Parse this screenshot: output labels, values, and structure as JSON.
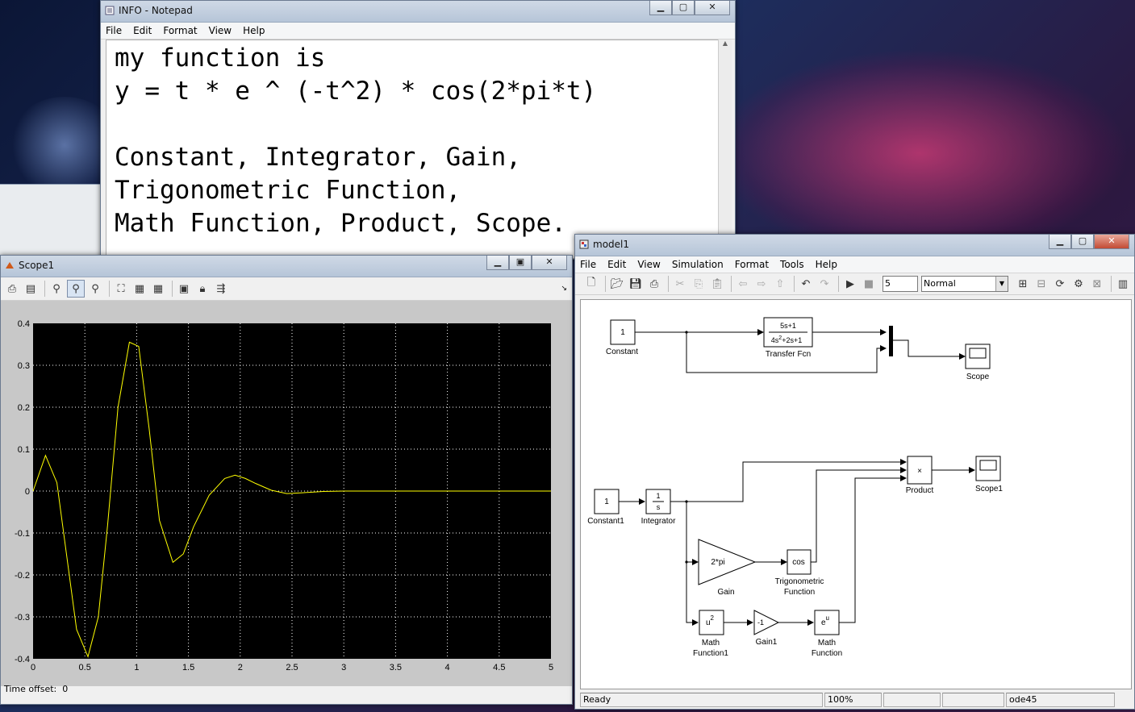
{
  "notepad": {
    "title": "INFO - Notepad",
    "menu": [
      "File",
      "Edit",
      "Format",
      "View",
      "Help"
    ],
    "lines": [
      "my function is",
      "y = t * e ^ (-t^2) * cos(2*pi*t)",
      "",
      "Constant, Integrator, Gain,",
      "Trigonometric Function,",
      "Math Function, Product, Scope."
    ]
  },
  "scope": {
    "title": "Scope1",
    "time_offset_label": "Time offset:",
    "time_offset_value": "0"
  },
  "chart_data": {
    "type": "line",
    "background": "#000000",
    "line_color": "#ffff00",
    "grid": true,
    "xlim": [
      0,
      5
    ],
    "ylim": [
      -0.4,
      0.4
    ],
    "xticks": [
      "0",
      "0.5",
      "1",
      "1.5",
      "2",
      "2.5",
      "3",
      "3.5",
      "4",
      "4.5",
      "5"
    ],
    "yticks": [
      "0.4",
      "0.3",
      "0.2",
      "0.1",
      "0",
      "-0.1",
      "-0.2",
      "-0.3",
      "-0.4"
    ],
    "x": [
      0,
      0.12,
      0.23,
      0.42,
      0.53,
      0.63,
      0.72,
      0.82,
      0.93,
      1.02,
      1.12,
      1.22,
      1.35,
      1.45,
      1.55,
      1.7,
      1.85,
      1.95,
      2.05,
      2.15,
      2.3,
      2.45,
      2.6,
      2.8,
      3.0,
      3.5,
      4.0,
      4.5,
      5.0
    ],
    "y": [
      0,
      0.085,
      0.02,
      -0.33,
      -0.395,
      -0.3,
      -0.08,
      0.2,
      0.355,
      0.345,
      0.15,
      -0.07,
      -0.17,
      -0.15,
      -0.085,
      -0.01,
      0.03,
      0.038,
      0.03,
      0.018,
      0.002,
      -0.006,
      -0.004,
      -0.001,
      0,
      0,
      0,
      0,
      0
    ]
  },
  "model": {
    "title": "model1",
    "menu": [
      "File",
      "Edit",
      "View",
      "Simulation",
      "Format",
      "Tools",
      "Help"
    ],
    "stop_time": "5",
    "sim_mode": "Normal",
    "status": {
      "ready": "Ready",
      "zoom": "100%",
      "solver": "ode45"
    },
    "blocks": {
      "constant": {
        "value": "1",
        "label": "Constant"
      },
      "transfer_num": "5s+1",
      "transfer_den_a": "4s",
      "transfer_den_exp": "2",
      "transfer_den_b": "+2s+1",
      "transfer_label": "Transfer Fcn",
      "scope_label": "Scope",
      "constant1": {
        "value": "1",
        "label": "Constant1"
      },
      "integrator_num": "1",
      "integrator_den": "s",
      "integrator_label": "Integrator",
      "product_symbol": "×",
      "product_label": "Product",
      "scope1_label": "Scope1",
      "gain_value": "2*pi",
      "gain_label": "Gain",
      "trig_value": "cos",
      "trig_label_1": "Trigonometric",
      "trig_label_2": "Function",
      "math1_base": "u",
      "math1_exp": "2",
      "math1_label_1": "Math",
      "math1_label_2": "Function1",
      "gain1_value": "-1",
      "gain1_label": "Gain1",
      "math_base": "e",
      "math_exp": "u",
      "math_label_1": "Math",
      "math_label_2": "Function"
    }
  }
}
